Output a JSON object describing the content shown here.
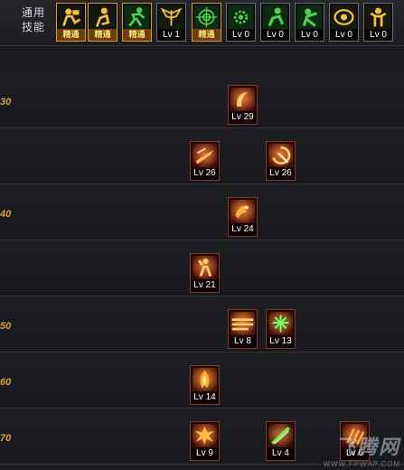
{
  "general_skills": {
    "label_line1": "通用",
    "label_line2": "技能",
    "icons": [
      {
        "name": "general-skill-1",
        "icon": "reading-figure-icon",
        "label": "精通",
        "mastered": true
      },
      {
        "name": "general-skill-2",
        "icon": "crouch-figure-icon",
        "label": "精通",
        "mastered": true
      },
      {
        "name": "general-skill-3",
        "icon": "running-figure-icon",
        "label": "精通",
        "mastered": true
      },
      {
        "name": "general-skill-4",
        "icon": "winged-emblem-icon",
        "label": "Lv 1",
        "mastered": false
      },
      {
        "name": "general-skill-5",
        "icon": "target-crosshair-icon",
        "label": "精通",
        "mastered": true
      },
      {
        "name": "general-skill-6",
        "icon": "green-gear-icon",
        "label": "Lv 0",
        "mastered": false
      },
      {
        "name": "general-skill-7",
        "icon": "green-kneel-figure-icon",
        "label": "Lv 0",
        "mastered": false
      },
      {
        "name": "general-skill-8",
        "icon": "green-strike-figure-icon",
        "label": "Lv 0",
        "mastered": false
      },
      {
        "name": "general-skill-9",
        "icon": "eye-ring-icon",
        "label": "Lv 0",
        "mastered": false
      },
      {
        "name": "general-skill-10",
        "icon": "strongman-figure-icon",
        "label": "Lv 0",
        "mastered": false
      }
    ]
  },
  "rows": [
    {
      "level": "30",
      "skills": [
        {
          "label": "Lv 29",
          "icon": "crescent-slash-icon",
          "color": "#c0301a"
        }
      ]
    },
    {
      "level": "",
      "skills": [
        {
          "label": "Lv 26",
          "icon": "blade-sweep-icon",
          "color": "#b02818"
        },
        {
          "label": "Lv 26",
          "icon": "spiral-axe-icon",
          "color": "#c03a1c"
        }
      ]
    },
    {
      "level": "40",
      "skills": [
        {
          "label": "Lv 24",
          "icon": "flame-dragon-icon",
          "color": "#c8401a"
        }
      ]
    },
    {
      "level": "",
      "skills": [
        {
          "label": "Lv 21",
          "icon": "warrior-figure-icon",
          "color": "#a8261a"
        }
      ]
    },
    {
      "level": "50",
      "skills": [
        {
          "label": "Lv 8",
          "icon": "fire-wave-icon",
          "color": "#d0481c"
        },
        {
          "label": "Lv 13",
          "icon": "green-burst-figure-icon",
          "color": "#8a2a1a"
        }
      ]
    },
    {
      "level": "60",
      "skills": [
        {
          "label": "Lv 14",
          "icon": "rising-flame-icon",
          "color": "#c8501c"
        }
      ]
    },
    {
      "level": "70",
      "skills": [
        {
          "label": "Lv 9",
          "icon": "explosion-icon",
          "color": "#c0301a"
        },
        {
          "label": "Lv 4",
          "icon": "green-slash-icon",
          "color": "#7a2a1a"
        },
        {
          "label": "Lv 6",
          "icon": "red-claw-icon",
          "color": "#b83020"
        }
      ]
    }
  ],
  "watermark": {
    "logo": "飞腾网",
    "url": "WWW.FPWAP.COM"
  }
}
